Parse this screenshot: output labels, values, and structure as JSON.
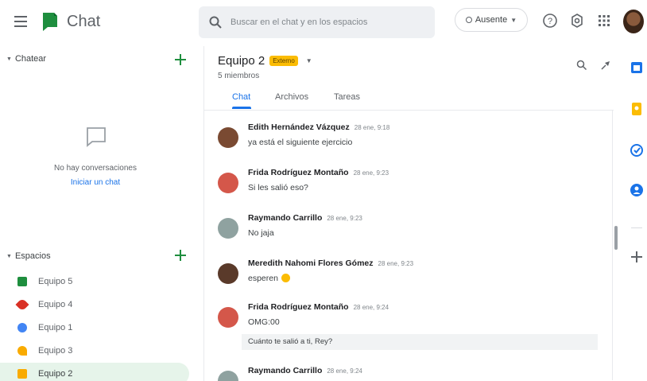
{
  "app": {
    "title": "Chat"
  },
  "search": {
    "placeholder": "Buscar en el chat y en los espacios"
  },
  "status": {
    "label": "Ausente"
  },
  "sidebar": {
    "chat_section": {
      "label": "Chatear",
      "empty_text": "No hay conversaciones",
      "start_link": "Iniciar un chat"
    },
    "spaces_section": {
      "label": "Espacios"
    },
    "spaces": [
      {
        "label": "Equipo 5",
        "color": "#1e8e3e",
        "active": false
      },
      {
        "label": "Equipo 4",
        "color": "#d93025",
        "active": false
      },
      {
        "label": "Equipo 1",
        "color": "#4285f4",
        "active": false
      },
      {
        "label": "Equipo 3",
        "color": "#f9ab00",
        "active": false
      },
      {
        "label": "Equipo 2",
        "color": "#f9ab00",
        "active": true
      }
    ]
  },
  "room": {
    "name": "Equipo 2",
    "badge": "Externo",
    "members": "5 miembros",
    "tabs": [
      {
        "label": "Chat",
        "active": true
      },
      {
        "label": "Archivos",
        "active": false
      },
      {
        "label": "Tareas",
        "active": false
      }
    ]
  },
  "messages": [
    {
      "author": "Edith Hernández Vázquez",
      "time": "28 ene, 9:18",
      "text": "ya está el siguiente ejercicio",
      "avatar_color": "#7a4a32"
    },
    {
      "author": "Frida Rodríguez Montaño",
      "time": "28 ene, 9:23",
      "text": "Si les salió eso?",
      "avatar_color": "#d4574a"
    },
    {
      "author": "Raymando Carrillo",
      "time": "28 ene, 9:23",
      "text": "No jaja",
      "avatar_color": "#8fa2a0"
    },
    {
      "author": "Meredith Nahomi Flores Gómez",
      "time": "28 ene, 9:23",
      "text": "esperen",
      "avatar_color": "#5a3a2a",
      "emoji": true
    },
    {
      "author": "Frida Rodríguez Montaño",
      "time": "28 ene, 9:24",
      "text": "OMG:00",
      "text2": "Cuánto te salió a ti, Rey?",
      "avatar_color": "#d4574a"
    },
    {
      "author": "Raymando Carrillo",
      "time": "28 ene, 9:24",
      "text": "",
      "avatar_color": "#8fa2a0"
    }
  ],
  "colors": {
    "accent": "#1a73e8",
    "brand_green": "#1e8e3e",
    "badge_yellow": "#fbbc04"
  }
}
